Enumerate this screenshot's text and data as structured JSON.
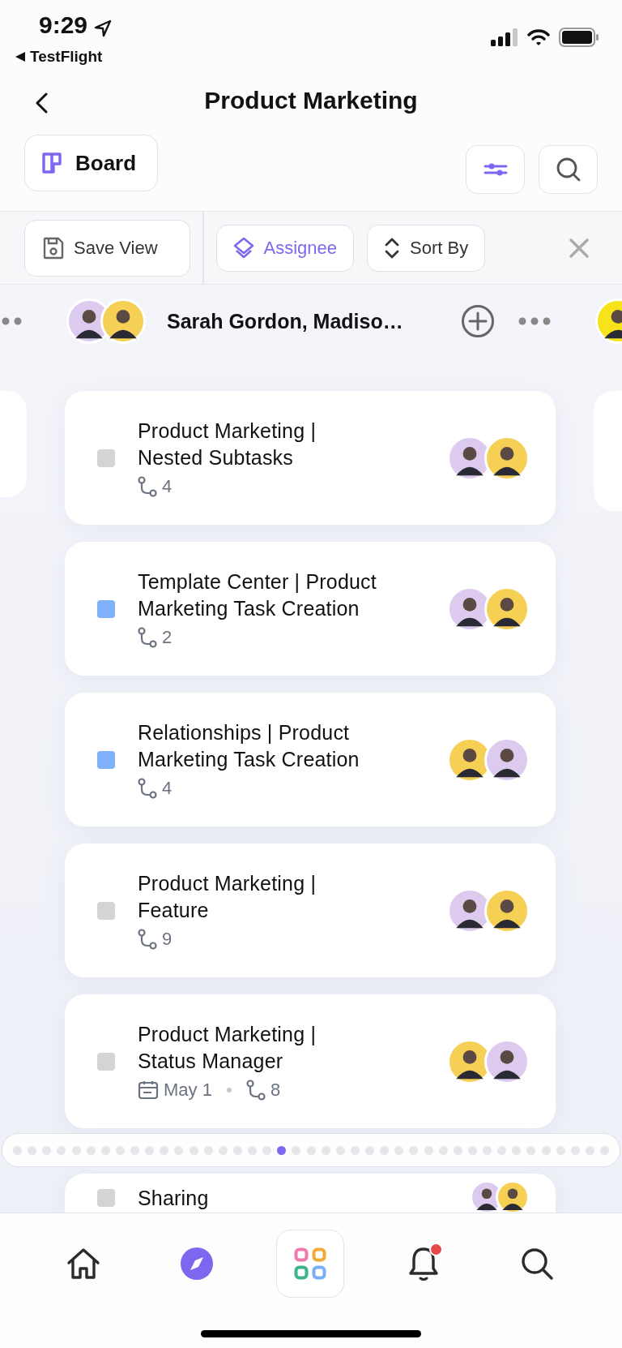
{
  "status_bar": {
    "time": "9:29",
    "back_app": "TestFlight"
  },
  "header": {
    "title": "Product Marketing"
  },
  "view": {
    "label": "Board"
  },
  "toolbar": {
    "save_view": "Save View",
    "chips": [
      {
        "label": "Assignee",
        "selected": true
      },
      {
        "label": "Sort By",
        "selected": false
      }
    ]
  },
  "group": {
    "name": "Sarah Gordon, Madiso…",
    "avatars": [
      {
        "color": "#dccbee"
      },
      {
        "color": "#f6cf55"
      }
    ]
  },
  "cards": [
    {
      "title": "Product Marketing |\nNested Subtasks",
      "color": "#d4d4d4",
      "subtasks": "4",
      "assignees": [
        {
          "color": "#dccbee"
        },
        {
          "color": "#f6cf55"
        }
      ]
    },
    {
      "title": "Template Center | Product\nMarketing Task Creation",
      "color": "#7fb0fb",
      "subtasks": "2",
      "assignees": [
        {
          "color": "#dccbee"
        },
        {
          "color": "#f6cf55"
        }
      ]
    },
    {
      "title": "Relationships | Product\nMarketing Task Creation",
      "color": "#7fb0fb",
      "subtasks": "4",
      "assignees": [
        {
          "color": "#f6cf55"
        },
        {
          "color": "#dccbee"
        }
      ]
    },
    {
      "title": "Product Marketing |\nFeature",
      "color": "#d4d4d4",
      "subtasks": "9",
      "assignees": [
        {
          "color": "#dccbee"
        },
        {
          "color": "#f6cf55"
        }
      ]
    },
    {
      "title": "Product Marketing |\nStatus Manager",
      "color": "#d4d4d4",
      "due": "May 1",
      "subtasks": "8",
      "assignees": [
        {
          "color": "#f6cf55"
        },
        {
          "color": "#dccbee"
        }
      ]
    },
    {
      "title": "Sharing",
      "color": "#d4d4d4",
      "assignees": [
        {
          "color": "#dccbee"
        },
        {
          "color": "#f6cf55"
        }
      ]
    }
  ],
  "page_dots": [
    {
      "selected": false
    },
    {
      "selected": false
    },
    {
      "selected": false
    },
    {
      "selected": false
    },
    {
      "selected": false
    },
    {
      "selected": false
    },
    {
      "selected": false
    },
    {
      "selected": false
    },
    {
      "selected": false
    },
    {
      "selected": false
    },
    {
      "selected": false
    },
    {
      "selected": false
    },
    {
      "selected": false
    },
    {
      "selected": false
    },
    {
      "selected": false
    },
    {
      "selected": false
    },
    {
      "selected": false
    },
    {
      "selected": false
    },
    {
      "selected": true
    },
    {
      "selected": false
    },
    {
      "selected": false
    },
    {
      "selected": false
    },
    {
      "selected": false
    },
    {
      "selected": false
    },
    {
      "selected": false
    },
    {
      "selected": false
    },
    {
      "selected": false
    },
    {
      "selected": false
    },
    {
      "selected": false
    },
    {
      "selected": false
    },
    {
      "selected": false
    },
    {
      "selected": false
    },
    {
      "selected": false
    },
    {
      "selected": false
    },
    {
      "selected": false
    },
    {
      "selected": false
    },
    {
      "selected": false
    },
    {
      "selected": false
    },
    {
      "selected": false
    },
    {
      "selected": false
    },
    {
      "selected": false
    }
  ],
  "nav": [
    {
      "kind": "home",
      "selected": false
    },
    {
      "kind": "explore",
      "selected": true
    },
    {
      "kind": "apps",
      "selected": false
    },
    {
      "kind": "notifications",
      "selected": false,
      "badge": true
    },
    {
      "kind": "search",
      "selected": false
    }
  ]
}
